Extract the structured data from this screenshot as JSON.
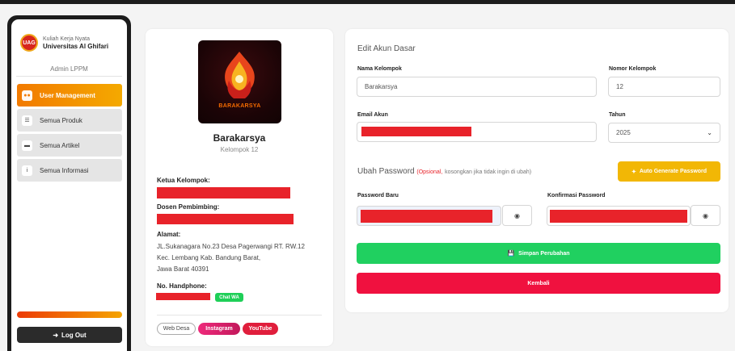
{
  "sidebar": {
    "brand_line1": "Kuliah Kerja Nyata",
    "brand_line2": "Universitas Al Ghifari",
    "role": "Admin LPPM",
    "items": [
      {
        "label": "User Management",
        "icon": "users-icon",
        "active": true
      },
      {
        "label": "Semua Produk",
        "icon": "product-icon",
        "active": false
      },
      {
        "label": "Semua Artikel",
        "icon": "article-icon",
        "active": false
      },
      {
        "label": "Semua Informasi",
        "icon": "info-icon",
        "active": false
      }
    ],
    "logout_label": "Log Out"
  },
  "profile": {
    "logo_text": "BARAKARSYA",
    "name": "Barakarsya",
    "group_number": "Kelompok 12",
    "leader_label": "Ketua Kelompok:",
    "advisor_label": "Dosen Pembimbing:",
    "address_label": "Alamat:",
    "address_lines": [
      "JL.Sukanagara No.23 Desa Pagerwangi RT. RW.12",
      "Kec. Lembang Kab. Bandung Barat,",
      "Jawa Barat 40391"
    ],
    "phone_label": "No. Handphone:",
    "chat_label": "Chat WA",
    "links": {
      "web": "Web Desa",
      "instagram": "Instagram",
      "youtube": "YouTube"
    }
  },
  "form": {
    "title": "Edit Akun Dasar",
    "group_name_label": "Nama Kelompok",
    "group_name_value": "Barakarsya",
    "group_number_label": "Nomor Kelompok",
    "group_number_value": "12",
    "email_label": "Email Akun",
    "year_label": "Tahun",
    "year_value": "2025",
    "password_section": {
      "title": "Ubah Password",
      "optional": "(Opsional,",
      "hint": "kosongkan jika tidak ingin di ubah)",
      "generate_label": "Auto Generate Password",
      "new_label": "Password Baru",
      "confirm_label": "Konfirmasi Password"
    },
    "save_label": "Simpan Perubahan",
    "back_label": "Kembali"
  },
  "colors": {
    "accent_orange": "#f27a00",
    "redaction": "#e8232a",
    "save_green": "#20d060",
    "back_red": "#f0113f",
    "generate_yellow": "#f2b705"
  }
}
